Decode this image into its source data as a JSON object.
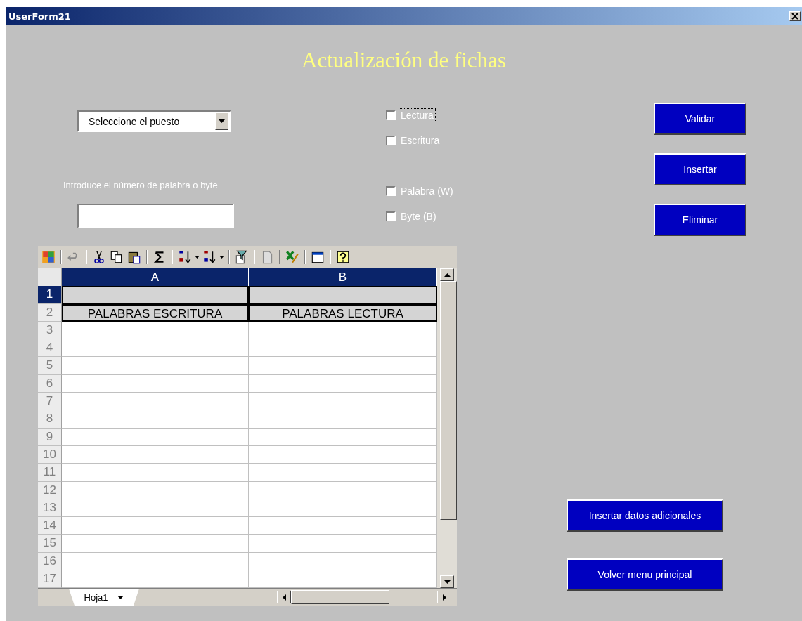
{
  "window": {
    "title": "UserForm21"
  },
  "form": {
    "heading": "Actualización de fichas",
    "dropdown": {
      "value": "Seleccione el puesto"
    },
    "number_label": "Introduce el número de palabra o byte",
    "checkboxes": [
      {
        "label": "Lectura",
        "checked": false,
        "focused": true
      },
      {
        "label": "Escritura",
        "checked": false,
        "focused": false
      },
      {
        "label": "Palabra (W)",
        "checked": false,
        "focused": false
      },
      {
        "label": "Byte (B)",
        "checked": false,
        "focused": false
      }
    ],
    "buttons": [
      "Validar",
      "Insertar",
      "Eliminar"
    ],
    "bottom_buttons": [
      "Insertar datos adicionales",
      "Volver menu principal"
    ]
  },
  "spreadsheet": {
    "columns": [
      "A",
      "B"
    ],
    "rows": [
      {
        "number": "1",
        "selected": true
      },
      {
        "number": "2",
        "selected": false,
        "cells": [
          "PALABRAS ESCRITURA",
          "PALABRAS LECTURA"
        ]
      },
      {
        "number": "3",
        "selected": false
      },
      {
        "number": "4",
        "selected": false
      },
      {
        "number": "5",
        "selected": false
      },
      {
        "number": "6",
        "selected": false
      },
      {
        "number": "7",
        "selected": false
      },
      {
        "number": "8",
        "selected": false
      },
      {
        "number": "9",
        "selected": false
      },
      {
        "number": "10",
        "selected": false
      },
      {
        "number": "11",
        "selected": false
      },
      {
        "number": "12",
        "selected": false
      },
      {
        "number": "13",
        "selected": false
      },
      {
        "number": "14",
        "selected": false
      },
      {
        "number": "15",
        "selected": false
      },
      {
        "number": "16",
        "selected": false
      },
      {
        "number": "17",
        "selected": false
      }
    ],
    "sheet_tab": "Hoja1"
  }
}
